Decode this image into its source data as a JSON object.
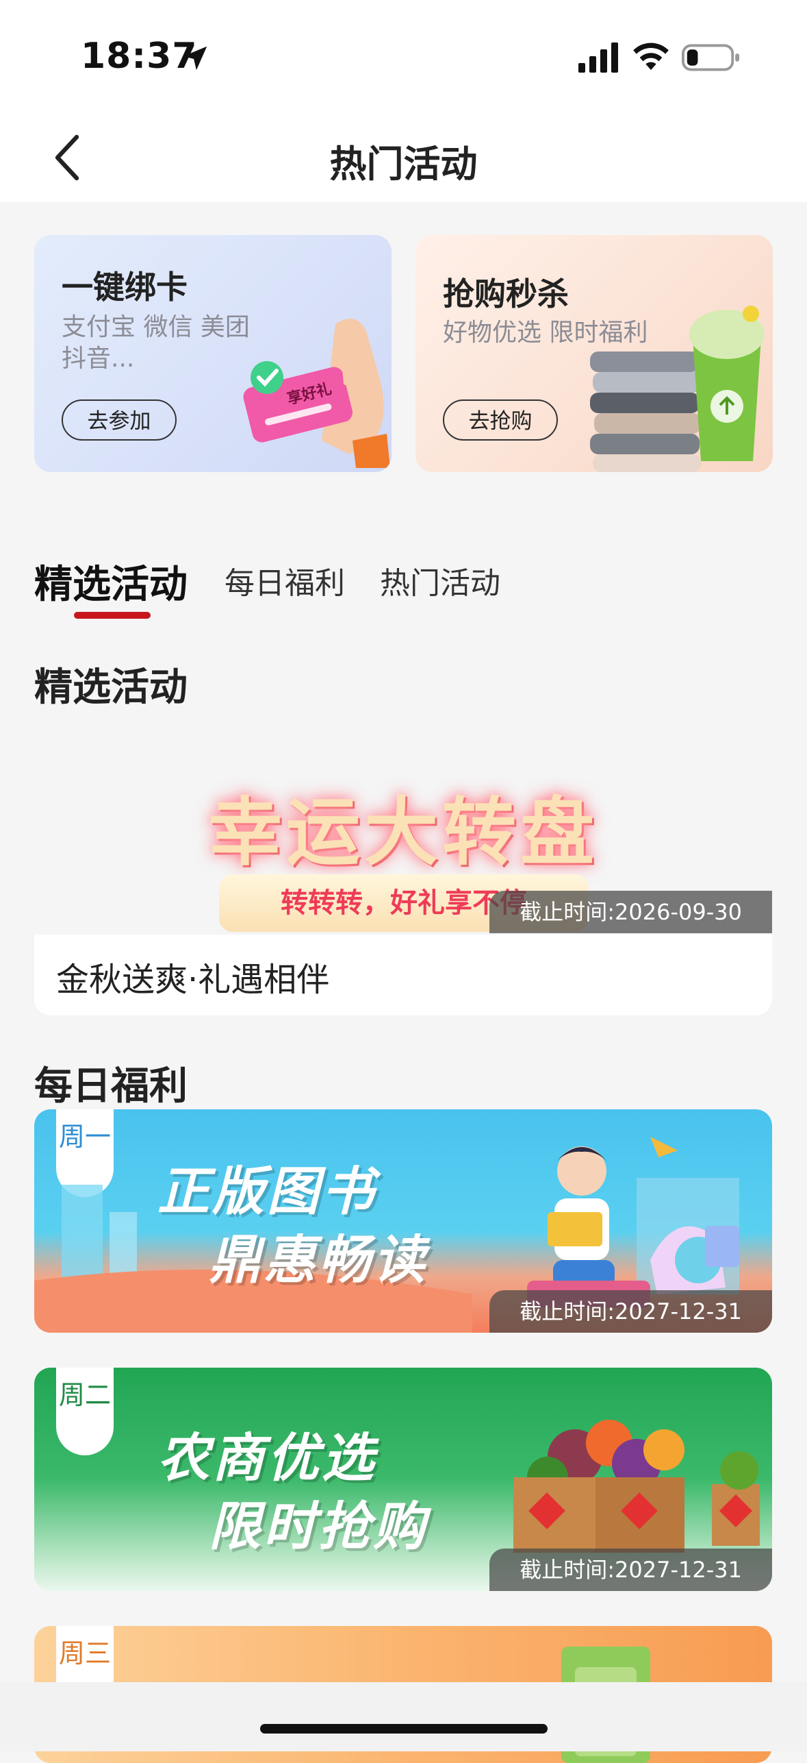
{
  "status_bar": {
    "time": "18:37"
  },
  "nav": {
    "title": "热门活动"
  },
  "promos": [
    {
      "title": "一键绑卡",
      "subtitle_line1": "支付宝  微信  美团",
      "subtitle_line2": "抖音...",
      "button": "去参加",
      "card_text": "享好礼"
    },
    {
      "title": "抢购秒杀",
      "subtitle_line1": "好物优选 限时福利",
      "button": "去抢购"
    }
  ],
  "tabs": [
    {
      "label": "精选活动",
      "active": true
    },
    {
      "label": "每日福利",
      "active": false
    },
    {
      "label": "热门活动",
      "active": false
    }
  ],
  "featured": {
    "heading": "精选活动",
    "banner_title": "幸运大转盘",
    "banner_sub": "转转转，好礼享不停",
    "deadline": "截止时间:2026-09-30",
    "name": "金秋送爽·礼遇相伴"
  },
  "daily": {
    "heading": "每日福利",
    "items": [
      {
        "weekday": "周一",
        "line1": "正版图书",
        "line2": "鼎惠畅读",
        "deadline": "截止时间:2027-12-31"
      },
      {
        "weekday": "周二",
        "line1": "农商优选",
        "line2": "限时抢购",
        "deadline": "截止时间:2027-12-31"
      },
      {
        "weekday": "周三"
      }
    ]
  },
  "colors": {
    "accent": "#c8161d",
    "background": "#f5f5f5"
  }
}
